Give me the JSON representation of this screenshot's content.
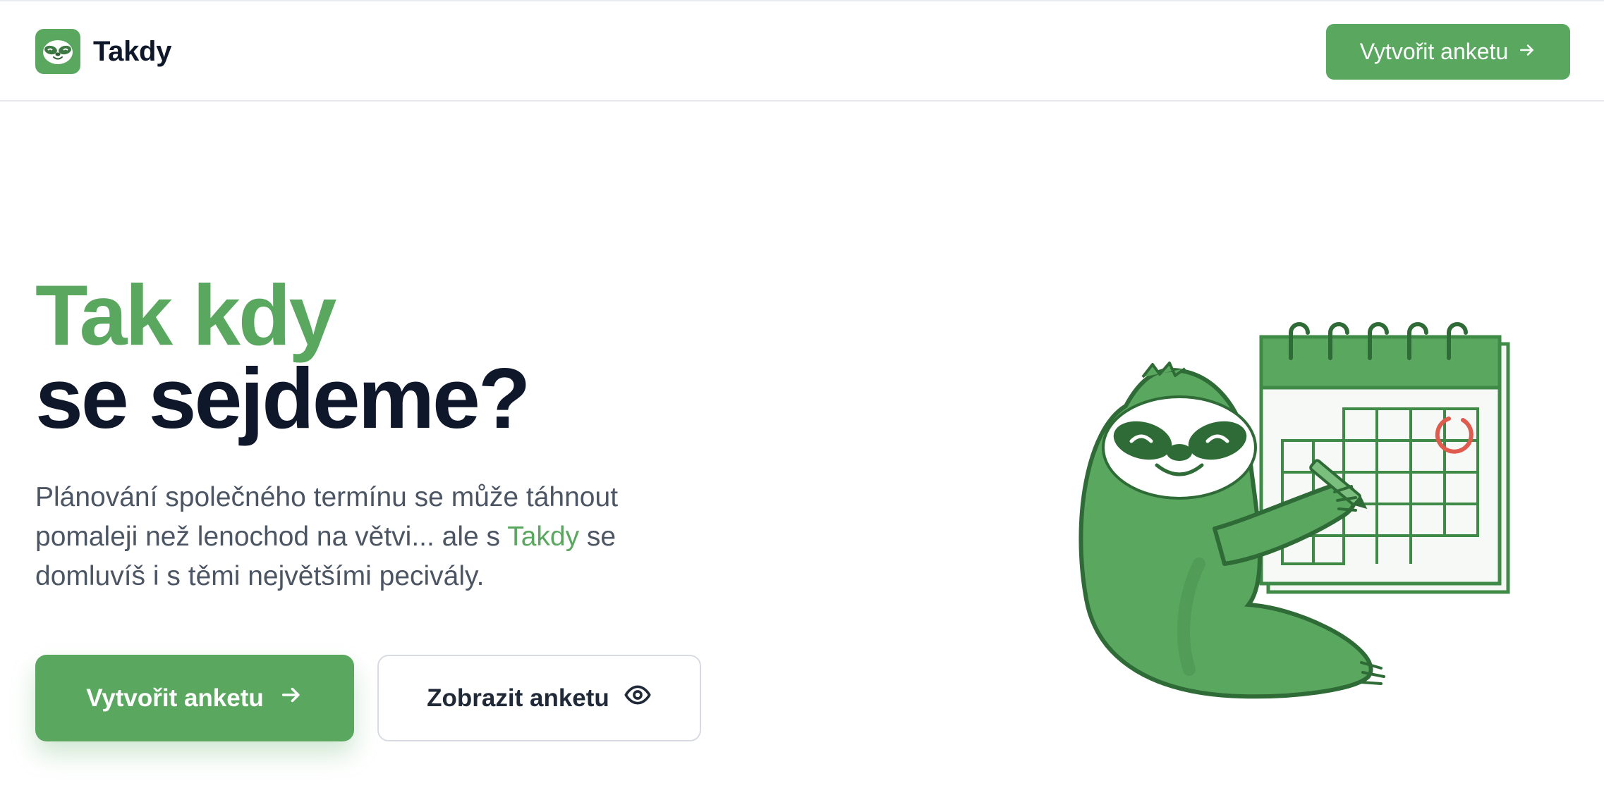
{
  "header": {
    "brand_name": "Takdy",
    "logo_icon": "sloth-face-icon",
    "cta_label": "Vytvořit anketu",
    "cta_icon": "arrow-right-icon"
  },
  "hero": {
    "title_line_1": "Tak kdy",
    "title_line_2": "se sejdeme?",
    "description_before": "Plánování společného termínu se může táhnout pomaleji než lenochod na větvi... ale s ",
    "description_brand": "Takdy",
    "description_after": " se domluvíš i s těmi největšími pecivály.",
    "primary_button_label": "Vytvořit anketu",
    "primary_button_icon": "arrow-right-icon",
    "secondary_button_label": "Zobrazit anketu",
    "secondary_button_icon": "eye-icon",
    "illustration": "sloth-with-calendar-illustration"
  },
  "colors": {
    "brand_green": "#5aa860",
    "dark_text": "#0f172a",
    "muted_text": "#4b5563",
    "calendar_mark": "#e05a4e"
  }
}
